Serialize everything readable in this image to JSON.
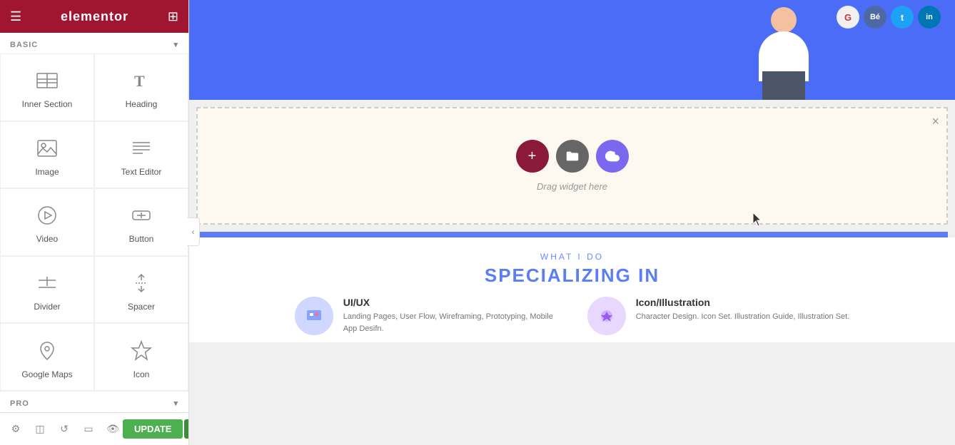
{
  "header": {
    "logo": "elementor",
    "hamburger_label": "☰",
    "grid_label": "⊞"
  },
  "panel": {
    "basic_label": "BASIC",
    "basic_chevron": "▾",
    "pro_label": "PRO",
    "pro_chevron": "▾",
    "widgets": [
      {
        "id": "inner-section",
        "label": "Inner Section",
        "icon": "inner-section-icon"
      },
      {
        "id": "heading",
        "label": "Heading",
        "icon": "heading-icon"
      },
      {
        "id": "image",
        "label": "Image",
        "icon": "image-icon"
      },
      {
        "id": "text-editor",
        "label": "Text Editor",
        "icon": "text-editor-icon"
      },
      {
        "id": "video",
        "label": "Video",
        "icon": "video-icon"
      },
      {
        "id": "button",
        "label": "Button",
        "icon": "button-icon"
      },
      {
        "id": "divider",
        "label": "Divider",
        "icon": "divider-icon"
      },
      {
        "id": "spacer",
        "label": "Spacer",
        "icon": "spacer-icon"
      },
      {
        "id": "google-maps",
        "label": "Google Maps",
        "icon": "map-icon"
      },
      {
        "id": "icon",
        "label": "Icon",
        "icon": "icon-icon"
      }
    ],
    "update_label": "UPDATE",
    "update_arrow": "▲"
  },
  "canvas": {
    "drop_zone_text": "Drag widget here",
    "drop_zone_close": "×",
    "drop_btn_add": "+",
    "drop_btn_folder": "▣",
    "drop_btn_cloud": "☁"
  },
  "what_i_do": {
    "subtitle": "WHAT I DO",
    "title": "SPECIALIZING IN",
    "service1_title": "UI/UX",
    "service1_desc": "Landing Pages, User Flow, Wireframing, Prototyping, Mobile App Desifn.",
    "service2_title": "Icon/Illustration",
    "service2_desc": "Character Design. Icon Set. Illustration Guide, Illustration Set."
  },
  "social": [
    {
      "color": "#cc3333",
      "label": "G"
    },
    {
      "color": "#4e69a2",
      "label": "B"
    },
    {
      "color": "#1da1f2",
      "label": "T"
    },
    {
      "color": "#0077b5",
      "label": "in"
    }
  ],
  "colors": {
    "header_bg": "#a01530",
    "panel_bg": "#ffffff",
    "hero_bg": "#4a6cf7",
    "drop_zone_bg": "#fdf8f0",
    "update_btn": "#4caf50",
    "accent_blue": "#5b7df7"
  }
}
